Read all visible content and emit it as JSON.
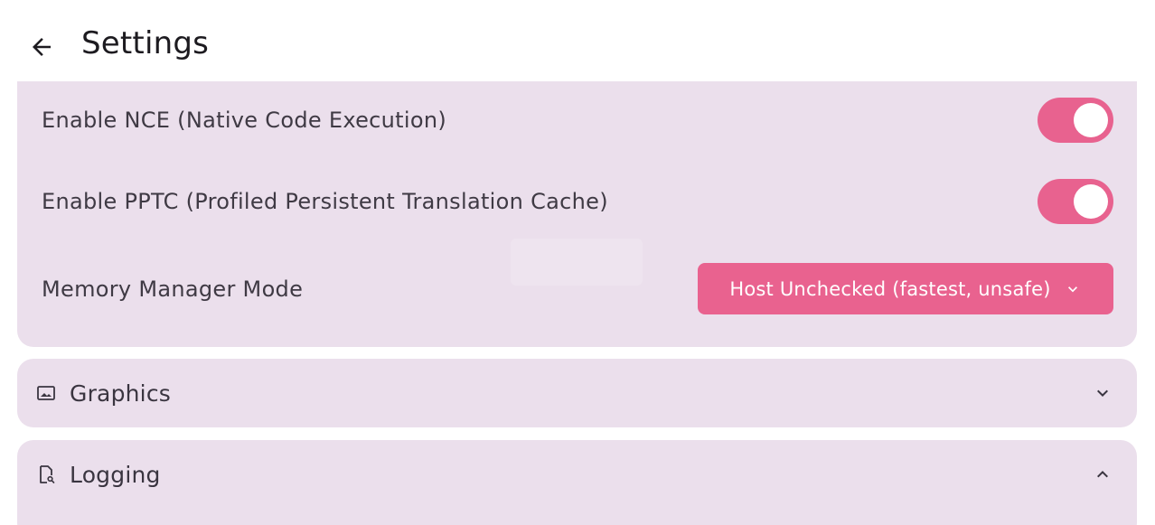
{
  "appbar": {
    "title": "Settings",
    "back_icon": "arrow-left-icon"
  },
  "cpu_settings": {
    "nce": {
      "label": "Enable NCE (Native Code Execution)",
      "enabled": true
    },
    "pptc": {
      "label": "Enable PPTC (Profiled Persistent Translation Cache)",
      "enabled": true
    },
    "memory_manager": {
      "label": "Memory Manager Mode",
      "selected": "Host Unchecked (fastest, unsafe)",
      "icon": "chevron-down-icon"
    }
  },
  "sections": {
    "graphics": {
      "title": "Graphics",
      "icon": "image-icon",
      "expanded": false,
      "chevron": "chevron-down-icon"
    },
    "logging": {
      "title": "Logging",
      "icon": "file-search-icon",
      "expanded": true,
      "chevron": "chevron-up-icon"
    }
  },
  "colors": {
    "accent": "#e8628f",
    "card": "#ebdfec",
    "background": "#ffffff",
    "text": "#3f3a44"
  }
}
